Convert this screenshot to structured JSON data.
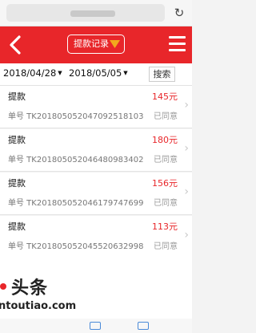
{
  "browser": {
    "reload_icon": "reload-icon",
    "reload_glyph": "↻"
  },
  "header": {
    "title": "提款记录",
    "background": "#e8262a",
    "accent": "#f2a81d",
    "back_icon": "chevron-left-icon",
    "menu_icon": "hamburger-menu-icon"
  },
  "filter": {
    "start_date": "2018/04/28",
    "end_date": "2018/05/05",
    "caret": "▼",
    "search_label": "搜索"
  },
  "records": [
    {
      "type": "提款",
      "amount": "145元",
      "order": "单号 TK20180505204709251810​3",
      "status": "已同意"
    },
    {
      "type": "提款",
      "amount": "180元",
      "order": "单号 TK20180505204648098340​2",
      "status": "已同意"
    },
    {
      "type": "提款",
      "amount": "156元",
      "order": "单号 TK20180505204617974769​9",
      "status": "已同意"
    },
    {
      "type": "提款",
      "amount": "113元",
      "order": "单号 TK20180505204552063299​8",
      "status": "已同意"
    }
  ],
  "watermark": {
    "brand": "头条",
    "url": "ntoutiao.com"
  }
}
